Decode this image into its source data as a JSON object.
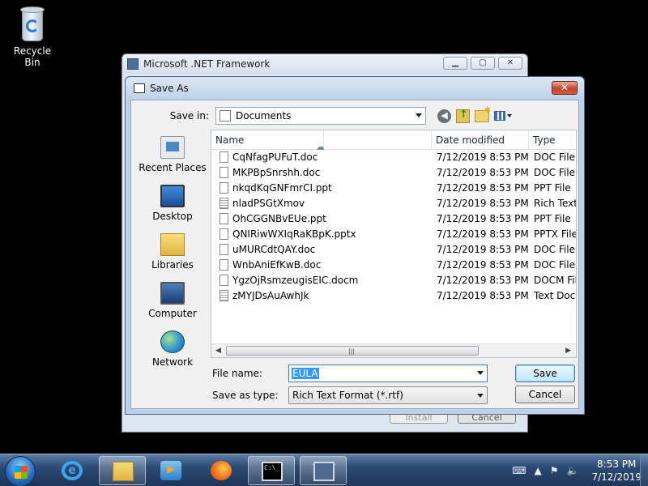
{
  "desktop": {
    "recycle_bin_label": "Recycle Bin"
  },
  "background_window": {
    "title": "Microsoft .NET Framework",
    "install_label": "Install",
    "cancel_label": "Cancel"
  },
  "dialog": {
    "title": "Save As",
    "close_label": "✕",
    "save_in_label": "Save in:",
    "save_in_value": "Documents",
    "places": [
      {
        "label": "Recent Places",
        "icon": "recent-places-icon"
      },
      {
        "label": "Desktop",
        "icon": "desktop-icon"
      },
      {
        "label": "Libraries",
        "icon": "libraries-icon"
      },
      {
        "label": "Computer",
        "icon": "computer-icon"
      },
      {
        "label": "Network",
        "icon": "network-icon"
      }
    ],
    "columns": {
      "name": "Name",
      "date": "Date modified",
      "type": "Type"
    },
    "files": [
      {
        "name": "CqNfagPUFuT.doc",
        "date": "7/12/2019 8:53 PM",
        "type": "DOC File"
      },
      {
        "name": "MKPBpSnrshh.doc",
        "date": "7/12/2019 8:53 PM",
        "type": "DOC File"
      },
      {
        "name": "nkqdKqGNFmrCI.ppt",
        "date": "7/12/2019 8:53 PM",
        "type": "PPT File"
      },
      {
        "name": "nladPSGtXmov",
        "date": "7/12/2019 8:53 PM",
        "type": "Rich Text"
      },
      {
        "name": "OhCGGNBvEUe.ppt",
        "date": "7/12/2019 8:53 PM",
        "type": "PPT File"
      },
      {
        "name": "QNIRiwWXIqRaKBpK.pptx",
        "date": "7/12/2019 8:53 PM",
        "type": "PPTX File"
      },
      {
        "name": "uMURCdtQAY.doc",
        "date": "7/12/2019 8:53 PM",
        "type": "DOC File"
      },
      {
        "name": "WnbAniEfKwB.doc",
        "date": "7/12/2019 8:53 PM",
        "type": "DOC File"
      },
      {
        "name": "YgzOjRsmzeugisEIC.docm",
        "date": "7/12/2019 8:53 PM",
        "type": "DOCM Fil"
      },
      {
        "name": "zMYJDsAuAwhJk",
        "date": "7/12/2019 8:53 PM",
        "type": "Text Docu"
      }
    ],
    "file_name_label": "File name:",
    "file_name_value": "EULA",
    "save_as_type_label": "Save as type:",
    "save_as_type_value": "Rich Text Format (*.rtf)",
    "save_label": "Save",
    "cancel_label": "Cancel"
  },
  "taskbar": {
    "items": [
      "start",
      "internet-explorer",
      "windows-explorer",
      "media-player",
      "firefox",
      "command-prompt",
      "network"
    ],
    "time": "8:53 PM",
    "date": "7/12/2019"
  }
}
